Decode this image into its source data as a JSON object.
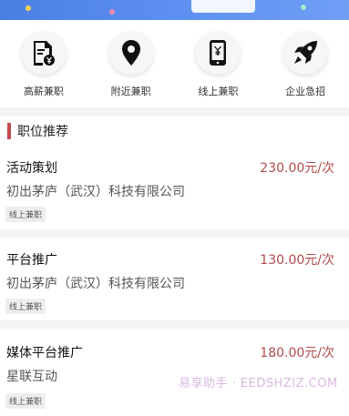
{
  "quick_links": [
    {
      "label": "高薪兼职",
      "icon": "document-yen-icon"
    },
    {
      "label": "附近兼职",
      "icon": "location-pin-icon"
    },
    {
      "label": "线上兼职",
      "icon": "phone-yen-icon"
    },
    {
      "label": "企业急招",
      "icon": "rocket-icon"
    }
  ],
  "section": {
    "title": "职位推荐"
  },
  "jobs": [
    {
      "title": "活动策划",
      "salary": "230.00元/次",
      "company": "初出茅庐（武汉）科技有限公司",
      "tag": "线上兼职"
    },
    {
      "title": "平台推广",
      "salary": "130.00元/次",
      "company": "初出茅庐（武汉）科技有限公司",
      "tag": "线上兼职"
    },
    {
      "title": "媒体平台推广",
      "salary": "180.00元/次",
      "company": "星联互动",
      "tag": "线上兼职"
    }
  ],
  "watermark": "易享助手 · EEDSHZIZ.COM",
  "colors": {
    "accent": "#c84a4a",
    "salary": "#b04a4a",
    "banner": "#5a8cf0"
  }
}
